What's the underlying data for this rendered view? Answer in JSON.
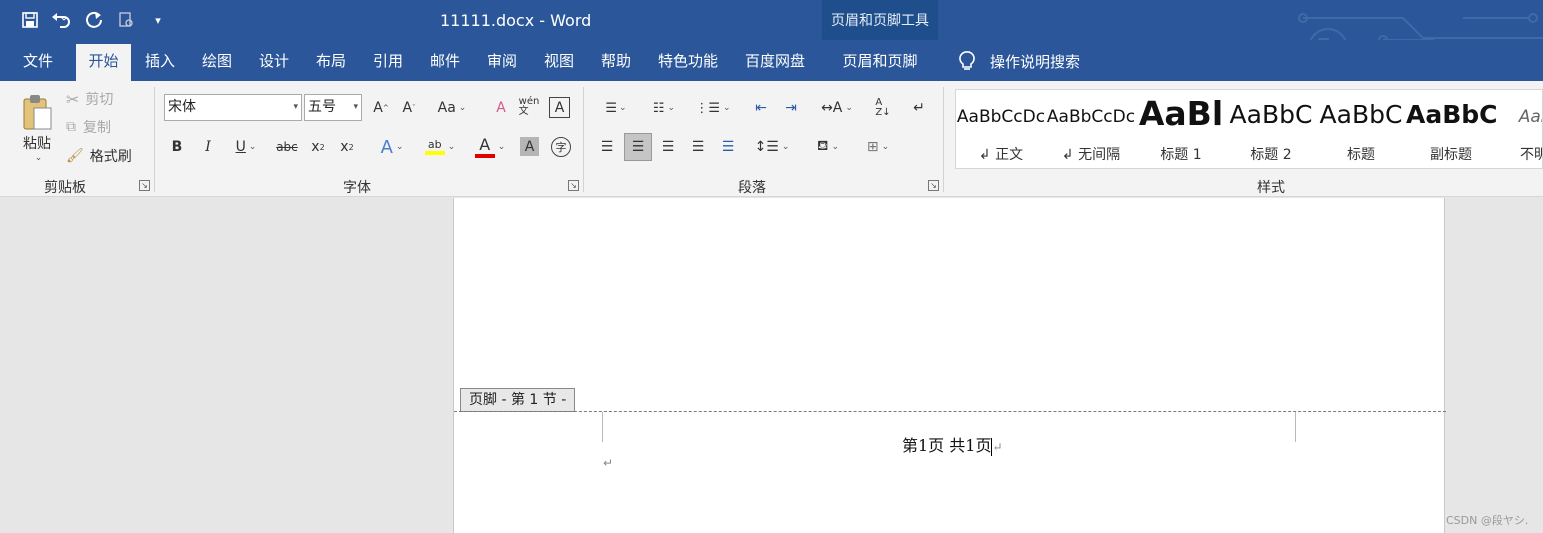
{
  "titlebar": {
    "title": "11111.docx  -  Word",
    "context_group": "页眉和页脚工具",
    "qat": [
      {
        "icon": "save-icon",
        "glyph": "🖫"
      },
      {
        "icon": "undo-icon",
        "glyph": "↶"
      },
      {
        "icon": "redo-icon",
        "glyph": "↻"
      },
      {
        "icon": "print-preview-icon",
        "glyph": "⎙"
      },
      {
        "icon": "customize-qat-icon",
        "glyph": "▾"
      }
    ]
  },
  "tabs": [
    "文件",
    "开始",
    "插入",
    "绘图",
    "设计",
    "布局",
    "引用",
    "邮件",
    "审阅",
    "视图",
    "帮助",
    "特色功能",
    "百度网盘",
    "页眉和页脚"
  ],
  "active_tab": "开始",
  "tell_me": "操作说明搜索",
  "clipboard": {
    "paste": "粘贴",
    "cut": "剪切",
    "copy": "复制",
    "format_painter": "格式刷",
    "group_label": "剪贴板"
  },
  "font": {
    "name": "宋体",
    "size": "五号",
    "group_label": "字体",
    "highlight_color": "#ffff00",
    "font_color": "#e00000"
  },
  "paragraph": {
    "group_label": "段落"
  },
  "styles": {
    "group_label": "样式",
    "items": [
      {
        "sample": "AaBbCcDc",
        "name": "↲ 正文"
      },
      {
        "sample": "AaBbCcDc",
        "name": "↲ 无间隔"
      },
      {
        "sample": "AaBl",
        "name": "标题 1"
      },
      {
        "sample": "AaBbC",
        "name": "标题 2"
      },
      {
        "sample": "AaBbC",
        "name": "标题"
      },
      {
        "sample": "AaBbC",
        "name": "副标题"
      },
      {
        "sample": "AaBb",
        "name": "不明显"
      }
    ]
  },
  "document": {
    "footer_tag": "页脚 - 第 1 节 -",
    "footer_text": "第1页  共1页",
    "para_mark": "↵"
  },
  "watermark": "CSDN @段ヤシ."
}
